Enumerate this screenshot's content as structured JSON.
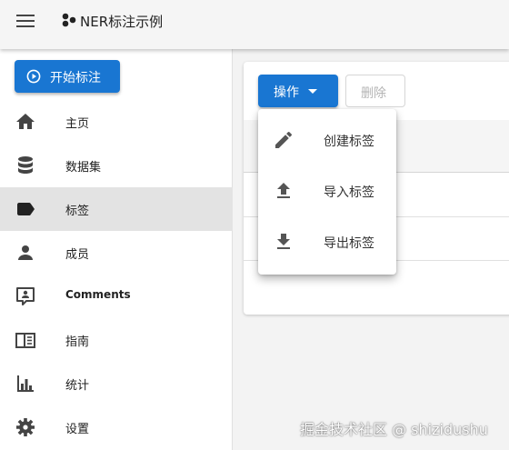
{
  "app": {
    "title": "NER标注示例"
  },
  "sidebar": {
    "start_button": "开始标注",
    "items": [
      {
        "label": "主页",
        "icon": "home-icon"
      },
      {
        "label": "数据集",
        "icon": "database-icon"
      },
      {
        "label": "标签",
        "icon": "label-icon",
        "active": true
      },
      {
        "label": "成员",
        "icon": "person-icon"
      },
      {
        "label": "Comments",
        "icon": "comment-account-icon"
      },
      {
        "label": "指南",
        "icon": "book-open-icon"
      },
      {
        "label": "统计",
        "icon": "chart-bar-icon"
      },
      {
        "label": "设置",
        "icon": "gear-icon"
      }
    ]
  },
  "toolbar": {
    "ops_label": "操作",
    "delete_label": "删除"
  },
  "menu": {
    "items": [
      {
        "label": "创建标签",
        "icon": "pencil-icon"
      },
      {
        "label": "导入标签",
        "icon": "upload-icon"
      },
      {
        "label": "导出标签",
        "icon": "download-icon"
      }
    ]
  },
  "watermark": "掘金技术社区 @ shizidushu",
  "colors": {
    "primary": "#1976d2",
    "active_bg": "#e3e3e3",
    "icon": "#444444"
  }
}
